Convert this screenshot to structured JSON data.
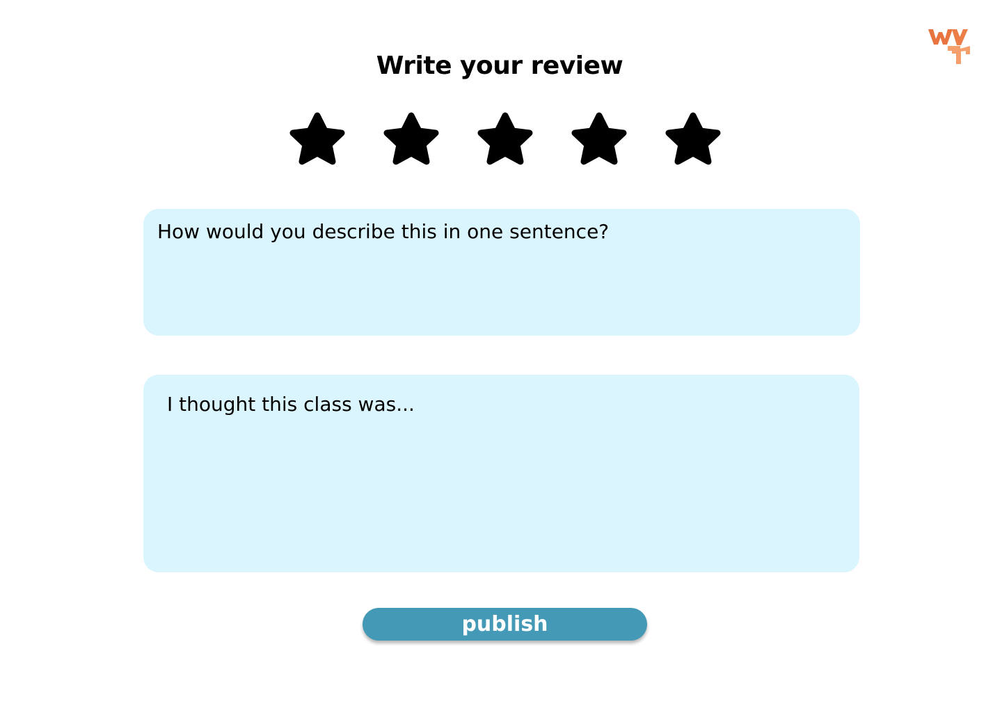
{
  "brand": {
    "logo_icon": "wyr-logo-icon",
    "logo_colors": [
      "#e8743f",
      "#f5a06c"
    ]
  },
  "review": {
    "title": "Write your review",
    "rating": {
      "value": 5,
      "max": 5,
      "star_color": "#000000"
    },
    "summary": {
      "placeholder": "How would you describe this in one sentence?",
      "value": ""
    },
    "details": {
      "placeholder": "I thought this class was...",
      "value": ""
    }
  },
  "actions": {
    "publish_label": "publish",
    "publish_color": "#4399b6"
  },
  "theme": {
    "field_background": "#daf5fd"
  }
}
